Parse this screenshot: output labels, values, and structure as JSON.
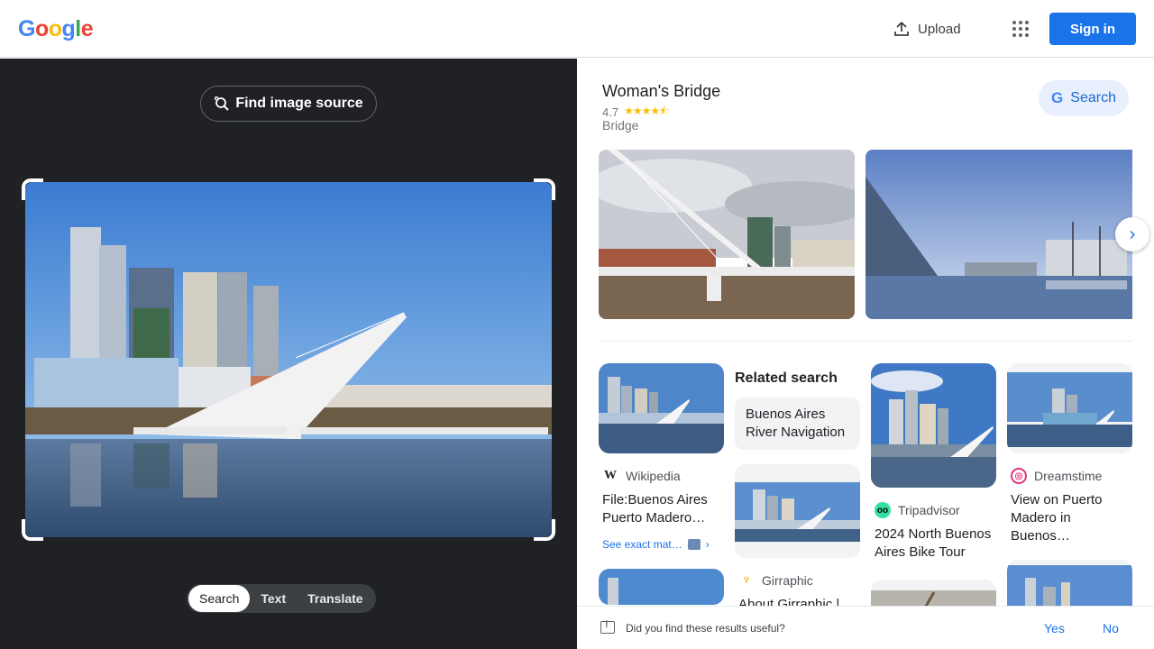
{
  "header": {
    "logo_letters": [
      "G",
      "o",
      "o",
      "g",
      "l",
      "e"
    ],
    "logo_colors": [
      "#4285f4",
      "#ea4335",
      "#fbbc05",
      "#4285f4",
      "#34a853",
      "#ea4335"
    ],
    "upload_label": "Upload",
    "signin_label": "Sign in"
  },
  "left": {
    "find_source_label": "Find image source",
    "tabs": [
      "Search",
      "Text",
      "Translate"
    ],
    "active_tab": "Search"
  },
  "knowledge_panel": {
    "title": "Woman's Bridge",
    "rating": "4.7",
    "stars": "★★★★⯪",
    "type": "Bridge",
    "search_label": "Search"
  },
  "results": {
    "col1": {
      "source_icon": "W",
      "source": "Wikipedia",
      "title": "File:Buenos Aires Puerto Madero…",
      "exact_label": "See exact mat…"
    },
    "col2": {
      "related_heading": "Related search",
      "chip": "Buenos Aires River Navigation",
      "source": "Girraphic",
      "title": "About Girraphic |"
    },
    "col3": {
      "source": "Tripadvisor",
      "title": "2024 North Buenos Aires Bike Tour"
    },
    "col4": {
      "source": "Dreamstime",
      "title": "View on Puerto Madero in Buenos…"
    }
  },
  "feedback": {
    "question": "Did you find these results useful?",
    "yes": "Yes",
    "no": "No"
  },
  "colors": {
    "accent": "#1a73e8",
    "dark_pane": "#202124",
    "star": "#fbbc04"
  }
}
